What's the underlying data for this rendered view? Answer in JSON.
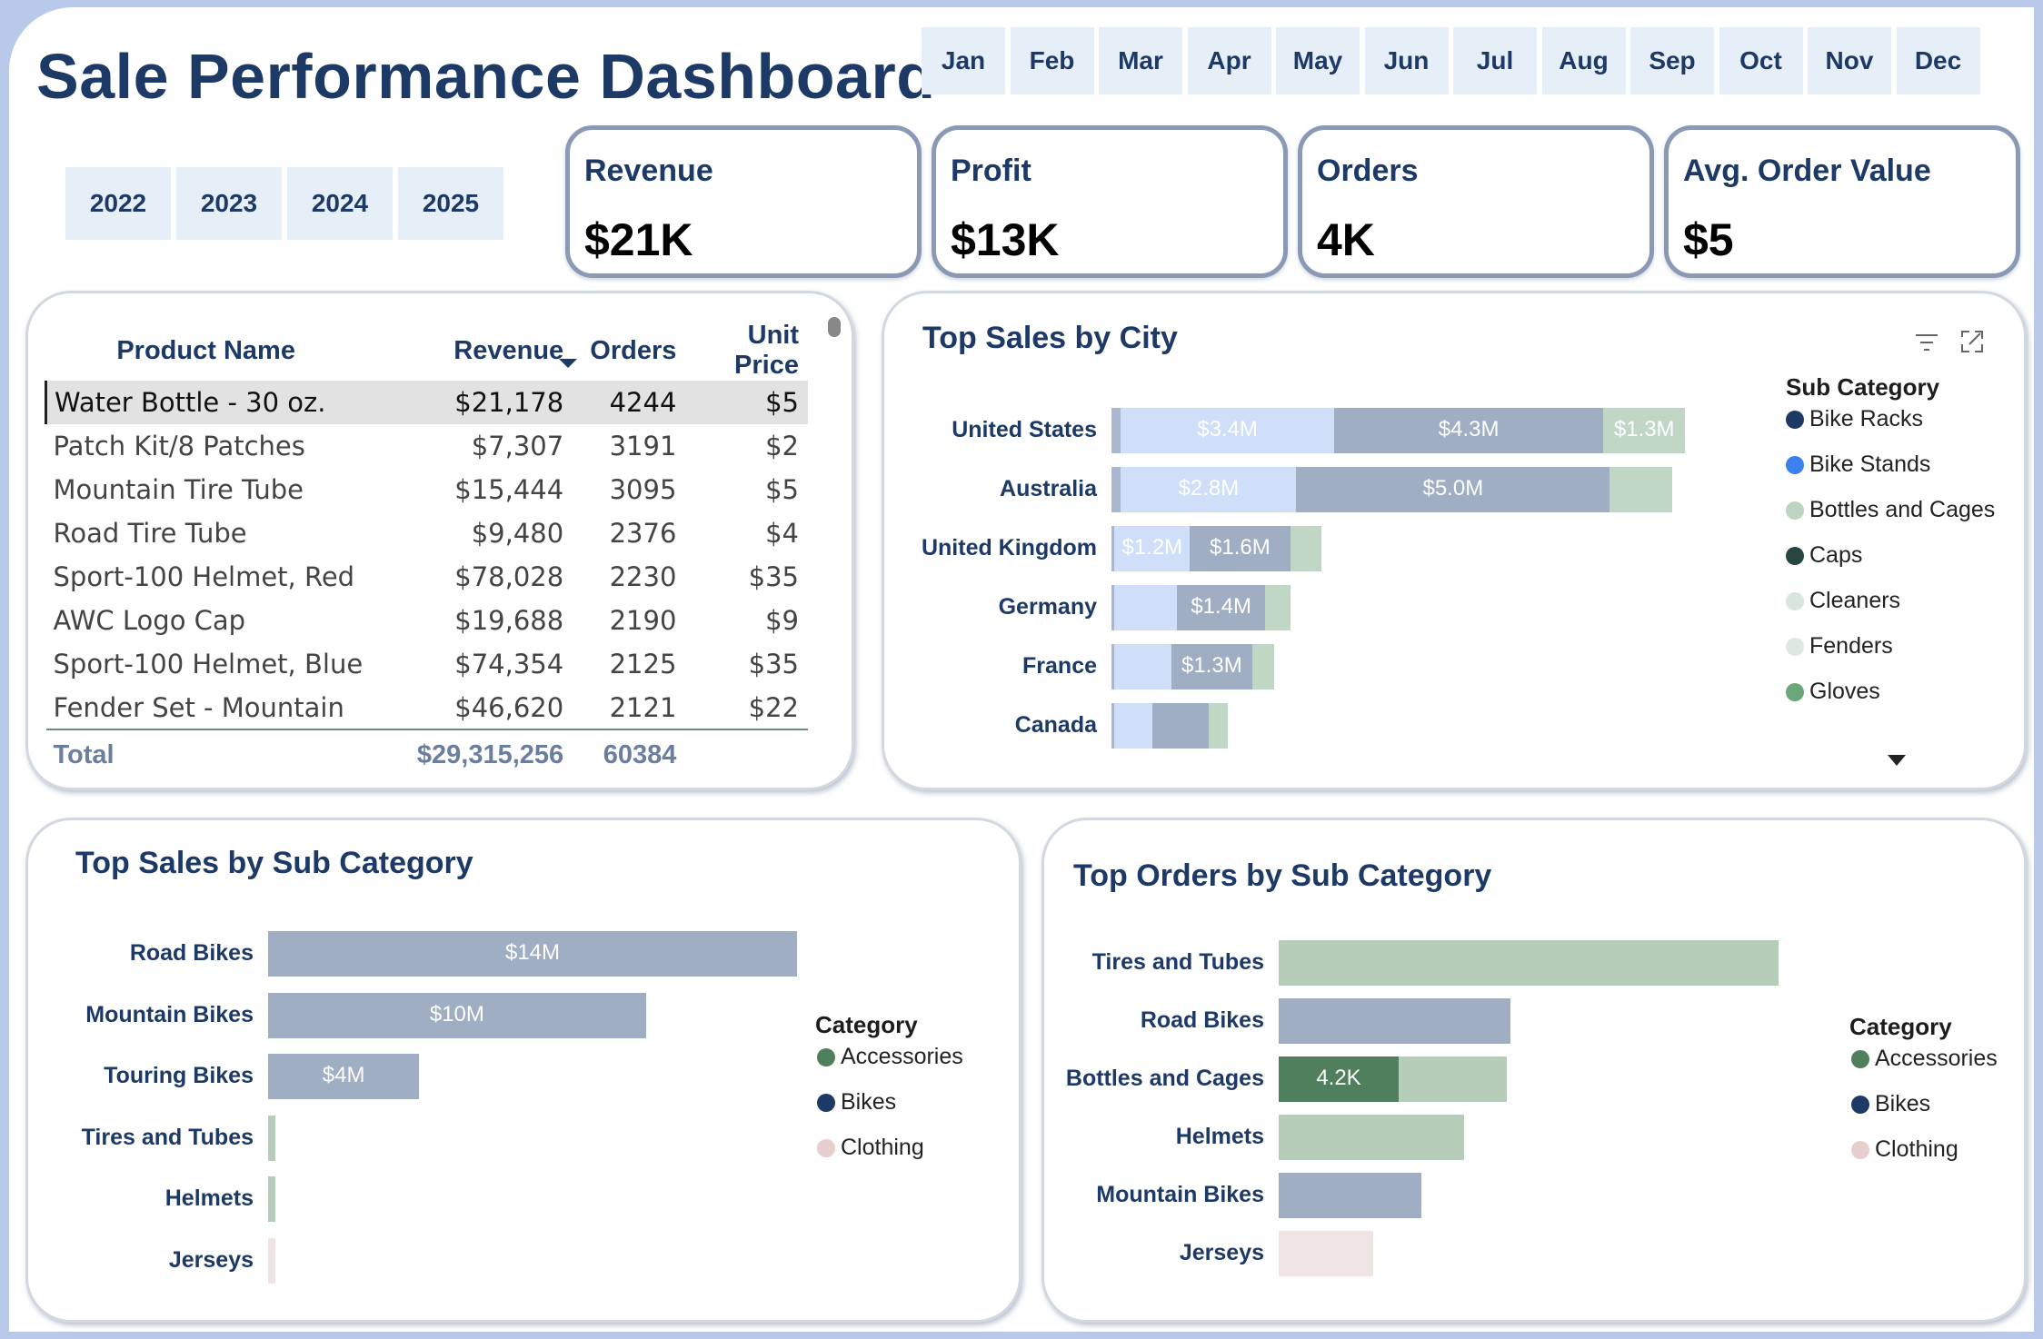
{
  "title": "Sale Performance Dashboard",
  "months": [
    "Jan",
    "Feb",
    "Mar",
    "Apr",
    "May",
    "Jun",
    "Jul",
    "Aug",
    "Sep",
    "Oct",
    "Nov",
    "Dec"
  ],
  "years": [
    "2022",
    "2023",
    "2024",
    "2025"
  ],
  "kpis": [
    {
      "label": "Revenue",
      "value": "$21K"
    },
    {
      "label": "Profit",
      "value": "$13K"
    },
    {
      "label": "Orders",
      "value": "4K"
    },
    {
      "label": "Avg. Order Value",
      "value": "$5"
    }
  ],
  "product_table": {
    "headers": [
      "Product Name",
      "Revenue",
      "Orders",
      "Unit Price"
    ],
    "rows": [
      [
        "Water Bottle - 30 oz.",
        "$21,178",
        "4244",
        "$5"
      ],
      [
        "Patch Kit/8 Patches",
        "$7,307",
        "3191",
        "$2"
      ],
      [
        "Mountain Tire Tube",
        "$15,444",
        "3095",
        "$5"
      ],
      [
        "Road Tire Tube",
        "$9,480",
        "2376",
        "$4"
      ],
      [
        "Sport-100 Helmet, Red",
        "$78,028",
        "2230",
        "$35"
      ],
      [
        "AWC Logo Cap",
        "$19,688",
        "2190",
        "$9"
      ],
      [
        "Sport-100 Helmet, Blue",
        "$74,354",
        "2125",
        "$35"
      ],
      [
        "Fender Set - Mountain",
        "$46,620",
        "2121",
        "$22"
      ]
    ],
    "total": [
      "Total",
      "$29,315,256",
      "60384",
      ""
    ]
  },
  "colors": {
    "bike_racks": "#1d3966",
    "bike_stands": "#3b7ff0",
    "bottles_and_cages": "#bcd4c2",
    "caps": "#274640",
    "cleaners": "#d8e6dc",
    "fenders": "#dee9e0",
    "gloves": "#6aa77a",
    "accessories": "#4f7f5c",
    "bikes": "#1d3966",
    "clothing": "#e7cfd0",
    "light_blue_seg": "#cfdff9",
    "steel_seg": "#a0aec4",
    "green_seg": "#b6cdb9",
    "pink_seg": "#efe3e3"
  },
  "city_chart": {
    "title": "Top Sales by City",
    "legend_title": "Sub Category",
    "legend": [
      {
        "name": "Bike Racks",
        "color": "#1d3966"
      },
      {
        "name": "Bike Stands",
        "color": "#3b7ff0"
      },
      {
        "name": "Bottles and Cages",
        "color": "#bcd4c2"
      },
      {
        "name": "Caps",
        "color": "#274640"
      },
      {
        "name": "Cleaners",
        "color": "#d8e6dc"
      },
      {
        "name": "Fenders",
        "color": "#dee9e0"
      },
      {
        "name": "Gloves",
        "color": "#6aa77a"
      }
    ],
    "chart_data": {
      "type": "bar",
      "orientation": "horizontal-stacked",
      "categories": [
        "United States",
        "Australia",
        "United Kingdom",
        "Germany",
        "France",
        "Canada"
      ],
      "unit": "$M",
      "segments": [
        {
          "values": [
            [
              0.15,
              "#a9b8cc",
              ""
            ],
            [
              3.4,
              "#cfdff9",
              "$3.4M"
            ],
            [
              4.3,
              "#a0aec4",
              "$4.3M"
            ],
            [
              1.3,
              "#c1d7c6",
              "$1.3M"
            ]
          ]
        },
        {
          "values": [
            [
              0.15,
              "#a9b8cc",
              ""
            ],
            [
              2.8,
              "#cfdff9",
              "$2.8M"
            ],
            [
              5.0,
              "#a0aec4",
              "$5.0M"
            ],
            [
              1.0,
              "#c1d7c6",
              ""
            ]
          ]
        },
        {
          "values": [
            [
              0.05,
              "#a9b8cc",
              ""
            ],
            [
              1.2,
              "#cfdff9",
              "$1.2M"
            ],
            [
              1.6,
              "#a0aec4",
              "$1.6M"
            ],
            [
              0.5,
              "#c1d7c6",
              ""
            ]
          ]
        },
        {
          "values": [
            [
              0.05,
              "#a9b8cc",
              ""
            ],
            [
              1.0,
              "#cfdff9",
              ""
            ],
            [
              1.4,
              "#a0aec4",
              "$1.4M"
            ],
            [
              0.4,
              "#c1d7c6",
              ""
            ]
          ]
        },
        {
          "values": [
            [
              0.05,
              "#a9b8cc",
              ""
            ],
            [
              0.9,
              "#cfdff9",
              ""
            ],
            [
              1.3,
              "#a0aec4",
              "$1.3M"
            ],
            [
              0.35,
              "#c1d7c6",
              ""
            ]
          ]
        },
        {
          "values": [
            [
              0.05,
              "#a9b8cc",
              ""
            ],
            [
              0.6,
              "#cfdff9",
              ""
            ],
            [
              0.9,
              "#a0aec4",
              ""
            ],
            [
              0.3,
              "#c1d7c6",
              ""
            ]
          ]
        }
      ]
    }
  },
  "subcat_sales": {
    "title": "Top Sales by Sub Category",
    "legend_title": "Category",
    "legend": [
      {
        "name": "Accessories",
        "color": "#4f7f5c"
      },
      {
        "name": "Bikes",
        "color": "#1d3966"
      },
      {
        "name": "Clothing",
        "color": "#e7cfd0"
      }
    ],
    "chart_data": {
      "type": "bar",
      "orientation": "horizontal",
      "categories": [
        "Road Bikes",
        "Mountain Bikes",
        "Touring Bikes",
        "Tires and Tubes",
        "Helmets",
        "Jerseys"
      ],
      "values": [
        14,
        10,
        4,
        0.2,
        0.2,
        0.15
      ],
      "unit": "$M",
      "labels": [
        "$14M",
        "$10M",
        "$4M",
        "",
        "",
        ""
      ],
      "bar_colors": [
        "#a0aec4",
        "#a0aec4",
        "#a0aec4",
        "#b6cdb9",
        "#b6cdb9",
        "#efe3e3"
      ],
      "max": 14
    }
  },
  "subcat_orders": {
    "title": "Top Orders by Sub Category",
    "legend_title": "Category",
    "legend": [
      {
        "name": "Accessories",
        "color": "#4f7f5c"
      },
      {
        "name": "Bikes",
        "color": "#1d3966"
      },
      {
        "name": "Clothing",
        "color": "#e7cfd0"
      }
    ],
    "chart_data": {
      "type": "bar",
      "orientation": "horizontal-stacked",
      "categories": [
        "Tires and Tubes",
        "Road Bikes",
        "Bottles and Cages",
        "Helmets",
        "Mountain Bikes",
        "Jerseys"
      ],
      "unit": "K orders",
      "segments": [
        {
          "values": [
            [
              17.5,
              "#b6cdb9",
              ""
            ]
          ]
        },
        {
          "values": [
            [
              8.1,
              "#a0aec4",
              ""
            ]
          ]
        },
        {
          "values": [
            [
              4.2,
              "#4f7f5c",
              "4.2K"
            ],
            [
              3.8,
              "#b6cdb9",
              ""
            ]
          ]
        },
        {
          "values": [
            [
              6.5,
              "#b6cdb9",
              ""
            ]
          ]
        },
        {
          "values": [
            [
              5.0,
              "#a0aec4",
              ""
            ]
          ]
        },
        {
          "values": [
            [
              3.3,
              "#efe3e3",
              ""
            ]
          ]
        }
      ],
      "max": 17.5
    }
  }
}
